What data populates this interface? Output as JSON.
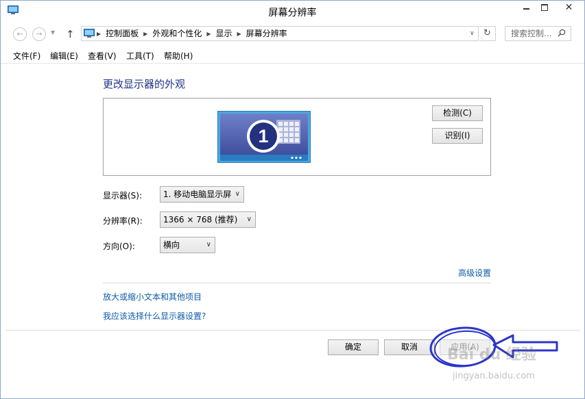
{
  "window": {
    "title": "屏幕分辨率"
  },
  "titlebar_buttons": {
    "close_glyph": "✕"
  },
  "nav": {
    "back_glyph": "←",
    "forward_glyph": "→",
    "recent_glyph": "▼",
    "up_glyph": "↑",
    "breadcrumb": [
      "控制面板",
      "外观和个性化",
      "显示",
      "屏幕分辨率"
    ],
    "separator": "▶",
    "dropdown_glyph": "∨",
    "refresh_glyph": "↻",
    "search_placeholder": "搜索控制..."
  },
  "menu": [
    "文件(F)",
    "编辑(E)",
    "查看(V)",
    "工具(T)",
    "帮助(H)"
  ],
  "main": {
    "heading": "更改显示器的外观",
    "monitor_number": "1",
    "detect_label": "检测(C)",
    "identify_label": "识别(I)",
    "fields": {
      "display_label": "显示器(S):",
      "display_value": "1. 移动电脑显示屏",
      "resolution_label": "分辨率(R):",
      "resolution_value": "1366 × 768 (推荐)",
      "orientation_label": "方向(O):",
      "orientation_value": "横向"
    },
    "advanced_link": "高级设置",
    "links": [
      "放大或缩小文本和其他项目",
      "我应该选择什么显示器设置?"
    ]
  },
  "footer": {
    "ok_label": "确定",
    "cancel_label": "取消",
    "apply_label": "应用(A)"
  },
  "annotation": {
    "color": "#2b35c8"
  },
  "watermark": {
    "logo": "Bai du 经验",
    "url": "jingyan.baidu.com"
  }
}
